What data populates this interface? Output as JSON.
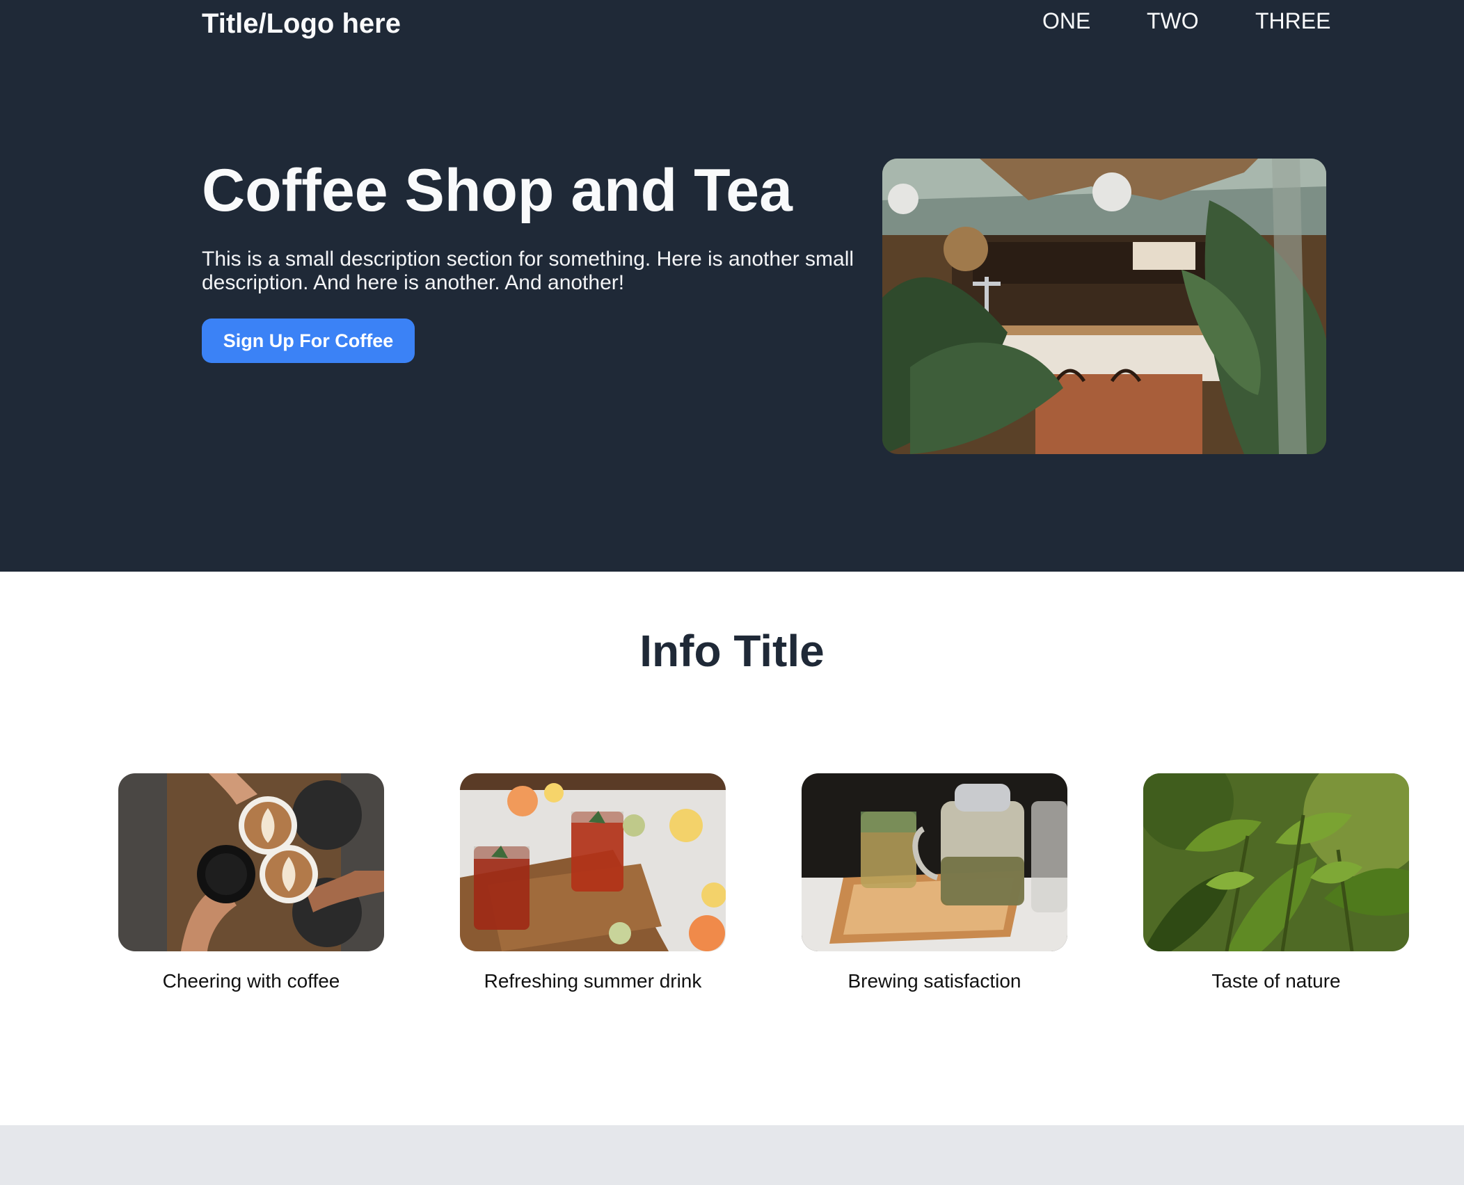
{
  "header": {
    "logo_text": "Title/Logo here",
    "nav": [
      "ONE",
      "TWO",
      "THREE"
    ]
  },
  "hero": {
    "title": "Coffee Shop and Tea",
    "description": "This is a small description section for something. Here is another small description. And here is another. And another!",
    "cta_label": "Sign Up For Coffee",
    "image": "coffee-shop-interior-photo"
  },
  "info": {
    "title": "Info Title",
    "cards": [
      {
        "caption": "Cheering with coffee",
        "image": "coffee-cups-toast-photo"
      },
      {
        "caption": "Refreshing summer drink",
        "image": "iced-tea-glasses-photo"
      },
      {
        "caption": "Brewing satisfaction",
        "image": "tea-pot-brewing-photo"
      },
      {
        "caption": "Taste of nature",
        "image": "tea-leaves-photo"
      }
    ]
  },
  "colors": {
    "hero_background": "#1f2937",
    "accent": "#3b82f6",
    "heading_dark": "#1f2937",
    "footer_background": "#e5e7eb"
  }
}
